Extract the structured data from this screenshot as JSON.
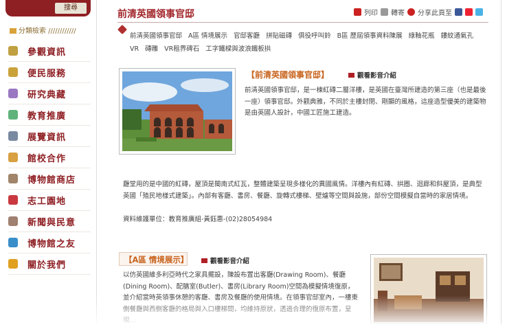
{
  "sidebar": {
    "search_button": "搜尋",
    "category_search": "分類檢索 ////////////",
    "menu": [
      {
        "label": "參觀資訊",
        "icon": "tools-icon",
        "color": "#c0a040"
      },
      {
        "label": "便民服務",
        "icon": "briefcase-icon",
        "color": "#c9a23a"
      },
      {
        "label": "研究典藏",
        "icon": "book-icon",
        "color": "#9b78c2"
      },
      {
        "label": "教育推廣",
        "icon": "calendar-icon",
        "color": "#5fb37a"
      },
      {
        "label": "展覽資訊",
        "icon": "map-icon",
        "color": "#7a8aa0"
      },
      {
        "label": "館校合作",
        "icon": "handshake-icon",
        "color": "#d8a040"
      },
      {
        "label": "博物館商店",
        "icon": "gift-icon",
        "color": "#a0856a"
      },
      {
        "label": "志工園地",
        "icon": "volunteer-icon",
        "color": "#c9393f"
      },
      {
        "label": "新聞與民意",
        "icon": "megaphone-icon",
        "color": "#a08070"
      },
      {
        "label": "博物館之友",
        "icon": "people-icon",
        "color": "#3a8fc9"
      },
      {
        "label": "關於我們",
        "icon": "info-icon",
        "color": "#e0a020"
      }
    ]
  },
  "main": {
    "title": "前清英國領事官邸",
    "share": {
      "print": "列印",
      "forward": "轉寄",
      "share_to": "分享此頁至"
    },
    "subnav": [
      "前清英國領事官邸",
      "A區 情境展示",
      "官邸客廳",
      "拼貼磁磚",
      "俱役呼叫鈴",
      "B區 歷屆領事資料陳展",
      "綠釉花瓶",
      "鏤紋通氣孔",
      "VR",
      "磚雕",
      "VR租界碑石",
      "工字鐵樑與波浪鐵板拱"
    ],
    "section1": {
      "title": "【前清英國領事官邸】",
      "video_link": "觀看影音介紹",
      "text": "前清英國領事官邸，是一棟紅磚二層洋樓，是英國在臺灣所建造的第三座（也是最後一座）領事官邸。外觀典雅，不同於主樓封閉、剛顯的風格，這座造型優美的建築物是由英國人設計，中國工匠施工建造。"
    },
    "paragraph2": "廳堂用的是中國的紅磚，屋頂是閩南式紅瓦，整體建築呈現多樣化的異國風情。洋樓內有紅磚、拱圈、迴廊和斜屋頂，是典型英國「殖民地樣式建築」。內部有客廳、書房、餐廳、旋轉式樓梯、壁爐等空間與設施，部份空間模擬自當時的家居情境。",
    "maintainer": "資料維護單位：教育推廣組-黃鈺惠-(02)28054984",
    "section2": {
      "title": "【A區 情境展示】",
      "video_link": "觀看影音介紹",
      "text": "以仿英國維多利亞時代之家具擺設，陳設布置出客廳(Drawing Room)、餐廳(Dining Room)、配膳室(Butler)、書房(Library Room)空間為模擬情境復原，並介紹當時英領事休憩的客廳、書房及餐廳的使用情境。在領事官邸室內，一樓東側餐廳與西側客廳的格局與入口樓梯間，均維持原狀，透過合理的復原布置，呈現..."
    },
    "colors": {
      "brand": "#8e1f23",
      "accent": "#c8641e",
      "title": "#a1262b"
    }
  }
}
